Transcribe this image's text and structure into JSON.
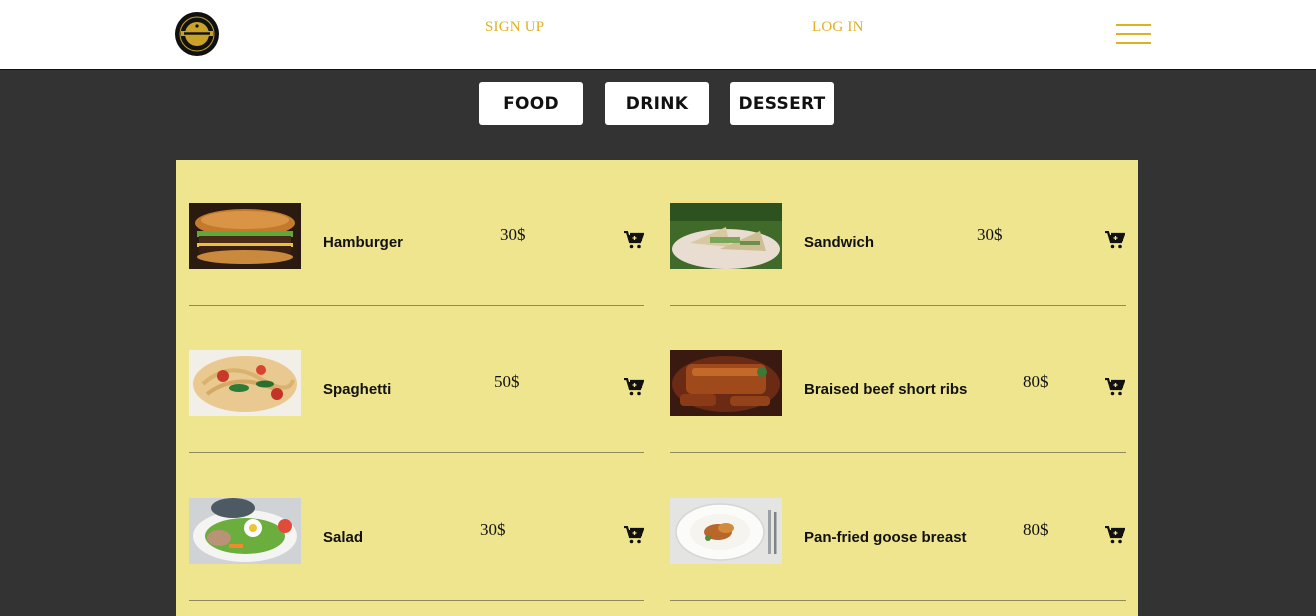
{
  "header": {
    "logo_icon": "restaurant-logo-icon",
    "signup_label": "SIGN UP",
    "login_label": "LOG IN",
    "menu_icon": "hamburger-menu-icon",
    "accent_color": "#e0b020"
  },
  "tabs": [
    {
      "label": "FOOD"
    },
    {
      "label": "DRINK"
    },
    {
      "label": "DESSERT"
    }
  ],
  "menu": {
    "background_color": "#efe58e",
    "cart_icon": "cart-plus-icon",
    "items": [
      {
        "name": "Hamburger",
        "price": "30$",
        "image": "hamburger-photo"
      },
      {
        "name": "Sandwich",
        "price": "30$",
        "image": "sandwich-photo"
      },
      {
        "name": "Spaghetti",
        "price": "50$",
        "image": "spaghetti-photo"
      },
      {
        "name": "Braised beef short ribs",
        "price": "80$",
        "image": "short-ribs-photo"
      },
      {
        "name": "Salad",
        "price": "30$",
        "image": "salad-photo"
      },
      {
        "name": "Pan-fried goose breast",
        "price": "80$",
        "image": "goose-breast-photo"
      }
    ]
  },
  "colors": {
    "page_background": "#333333",
    "header_background": "#ffffff"
  }
}
